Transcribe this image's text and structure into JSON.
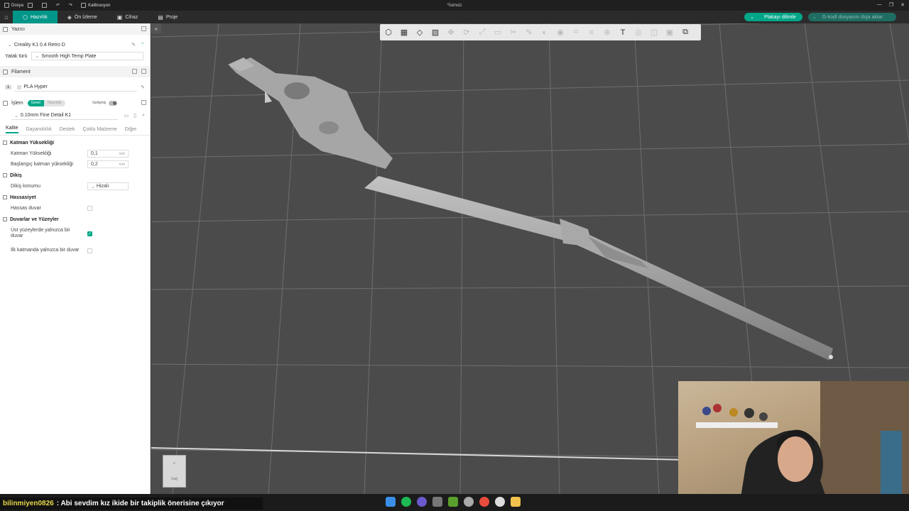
{
  "titlebar": {
    "file_label": "Dosya",
    "calibration_label": "Kalibrasyon",
    "doc_title": "*İsimsiz"
  },
  "menubar": {
    "tabs": [
      {
        "label": "Hazırlık",
        "active": true,
        "icon": "prepare-icon"
      },
      {
        "label": "Ön İzleme",
        "active": false,
        "icon": "preview-icon"
      },
      {
        "label": "Cihaz",
        "active": false,
        "icon": "device-icon"
      },
      {
        "label": "Proje",
        "active": false,
        "icon": "project-icon"
      }
    ],
    "slice_button": "Plakayı dilimle",
    "export_button": "G-kodl dosyasını dışa aktar"
  },
  "sidebar": {
    "printer_section": "Yazıcı",
    "printer_name": "Creality K1 0.4 Retro D",
    "bed_type_label": "Yatak türü",
    "bed_type_value": "Smooth High Temp Plate",
    "filament_section": "Filament",
    "filament_index": "1",
    "filament_name": "PLA Hyper",
    "process_section": "İşlem",
    "process_toggle_on": "Genel",
    "process_toggle_off": "Nesneler",
    "advanced_label": "Gelişmiş",
    "process_preset": "0.10mm Fine Detail K1",
    "tabs": [
      "Kalite",
      "Dayanıklılık",
      "Destek",
      "Çoklu Malzeme",
      "Diğer"
    ],
    "groups": {
      "layer_height": {
        "title": "Katman Yüksekliği",
        "layer_height_label": "Katman Yüksekliği",
        "layer_height_value": "0,1",
        "initial_layer_label": "Başlangıç katman yüksekliği",
        "initial_layer_value": "0,2",
        "unit": "mm"
      },
      "seam": {
        "title": "Dikiş",
        "position_label": "Dikiş konumu",
        "position_value": "Hizalı"
      },
      "precision": {
        "title": "Hassasiyet",
        "precise_wall_label": "Hassas duvar"
      },
      "walls": {
        "title": "Duvarlar ve Yüzeyler",
        "top_one_wall_label": "Üst yüzeylerde yalnızca bir duvar",
        "top_one_wall_checked": true,
        "first_layer_one_wall_label": "İlk katmanda yalnızca bir duvar",
        "first_layer_one_wall_checked": false
      }
    }
  },
  "viewport": {
    "navcube_label": "Sağ"
  },
  "chat": {
    "user": "bilinmiyen0826",
    "message": ": Abi sevdim kız ikide bir takiplik önerisine çıkıyor"
  },
  "colors": {
    "accent": "#00a687",
    "bed": "#4b4b4b",
    "grid": "#707070",
    "model": "#9a9a9a"
  }
}
